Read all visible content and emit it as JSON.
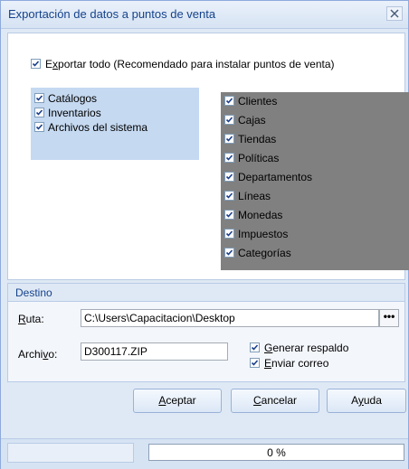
{
  "window": {
    "title": "Exportación de datos a puntos de venta",
    "close_icon": "close-x-icon"
  },
  "export_all": {
    "label_pre": "E",
    "label_mnemonic": "x",
    "label_post": "portar todo (Recomendado para instalar puntos de venta)",
    "checked": true
  },
  "left_group": {
    "items": [
      {
        "label": "Catálogos",
        "checked": true
      },
      {
        "label": "Inventarios",
        "checked": true
      },
      {
        "label": "Archivos del sistema",
        "checked": true
      }
    ]
  },
  "right_group": {
    "items": [
      {
        "label": "Clientes",
        "checked": true
      },
      {
        "label": "Cajas",
        "checked": true
      },
      {
        "label": "Tiendas",
        "checked": true
      },
      {
        "label": "Políticas",
        "checked": true
      },
      {
        "label": "Departamentos",
        "checked": true
      },
      {
        "label": "Líneas",
        "checked": true
      },
      {
        "label": "Monedas",
        "checked": true
      },
      {
        "label": "Impuestos",
        "checked": true
      },
      {
        "label": "Categorías",
        "checked": true
      }
    ]
  },
  "destino": {
    "header": "Destino",
    "ruta_label_mnemonic": "R",
    "ruta_label_rest": "uta:",
    "ruta_value": "C:\\Users\\Capacitacion\\Desktop",
    "browse_label": "•••",
    "archivo_label_pre": "Archi",
    "archivo_label_mnemonic": "v",
    "archivo_label_post": "o:",
    "archivo_value": "D300117.ZIP",
    "generar_mnemonic": "G",
    "generar_rest": "enerar respaldo",
    "generar_checked": true,
    "enviar_mnemonic": "E",
    "enviar_rest": "nviar correo",
    "enviar_checked": true
  },
  "buttons": {
    "aceptar_mnemonic": "A",
    "aceptar_rest": "ceptar",
    "cancelar_mnemonic": "C",
    "cancelar_rest": "ancelar",
    "ayuda_pre": "A",
    "ayuda_mnemonic": "y",
    "ayuda_post": "uda"
  },
  "status": {
    "progress_text": "0 %",
    "progress_value": 0
  },
  "colors": {
    "accent": "#15428b",
    "panel": "#dfe9f5",
    "disabled_area": "#808080",
    "selection": "#c5d9f1"
  }
}
